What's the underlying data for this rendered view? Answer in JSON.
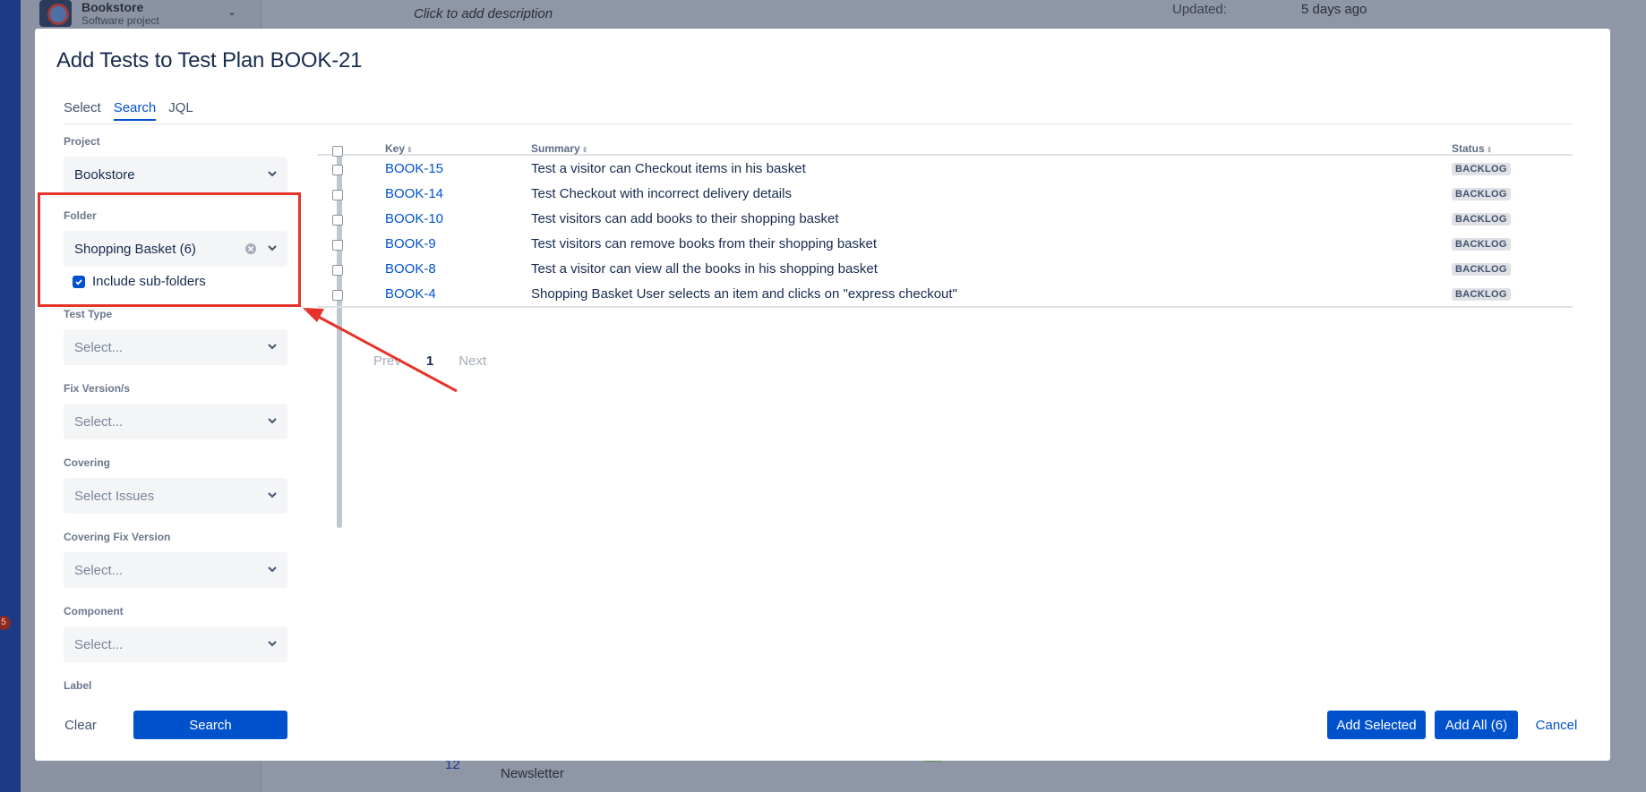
{
  "background": {
    "project_name": "Bookstore",
    "project_type": "Software project",
    "description_placeholder": "Click to add description",
    "updated_label": "Updated:",
    "updated_value": "5 days ago",
    "badge_count": "5",
    "bottom_number": "12",
    "bottom_text": "Newsletter"
  },
  "modal": {
    "title": "Add Tests to Test Plan BOOK-21",
    "tabs": [
      {
        "label": "Select",
        "active": false
      },
      {
        "label": "Search",
        "active": true
      },
      {
        "label": "JQL",
        "active": false
      }
    ],
    "filters": {
      "project": {
        "label": "Project",
        "value": "Bookstore"
      },
      "folder": {
        "label": "Folder",
        "value": "Shopping Basket (6)",
        "include_subfolders_label": "Include sub-folders",
        "include_subfolders": true
      },
      "test_type": {
        "label": "Test Type",
        "placeholder": "Select..."
      },
      "fix_version": {
        "label": "Fix Version/s",
        "placeholder": "Select..."
      },
      "covering": {
        "label": "Covering",
        "placeholder": "Select Issues"
      },
      "covering_fix_version": {
        "label": "Covering Fix Version",
        "placeholder": "Select..."
      },
      "component": {
        "label": "Component",
        "placeholder": "Select..."
      },
      "label": {
        "label": "Label"
      }
    },
    "table": {
      "columns": {
        "key": "Key",
        "summary": "Summary",
        "status": "Status"
      },
      "rows": [
        {
          "key": "BOOK-15",
          "summary": "Test a visitor can Checkout items in his basket",
          "status": "BACKLOG"
        },
        {
          "key": "BOOK-14",
          "summary": "Test Checkout with incorrect delivery details",
          "status": "BACKLOG"
        },
        {
          "key": "BOOK-10",
          "summary": "Test visitors can add books to their shopping basket",
          "status": "BACKLOG"
        },
        {
          "key": "BOOK-9",
          "summary": "Test visitors can remove books from their shopping basket",
          "status": "BACKLOG"
        },
        {
          "key": "BOOK-8",
          "summary": "Test a visitor can view all the books in his shopping basket",
          "status": "BACKLOG"
        },
        {
          "key": "BOOK-4",
          "summary": "Shopping Basket User selects an item and clicks on \"express checkout\"",
          "status": "BACKLOG"
        }
      ]
    },
    "pager": {
      "prev": "Prev",
      "current": "1",
      "next": "Next"
    },
    "footer": {
      "clear": "Clear",
      "search": "Search",
      "add_selected": "Add Selected",
      "add_all": "Add All (6)",
      "cancel": "Cancel"
    }
  },
  "colors": {
    "accent": "#0052cc",
    "annotation": "#e5332a"
  }
}
